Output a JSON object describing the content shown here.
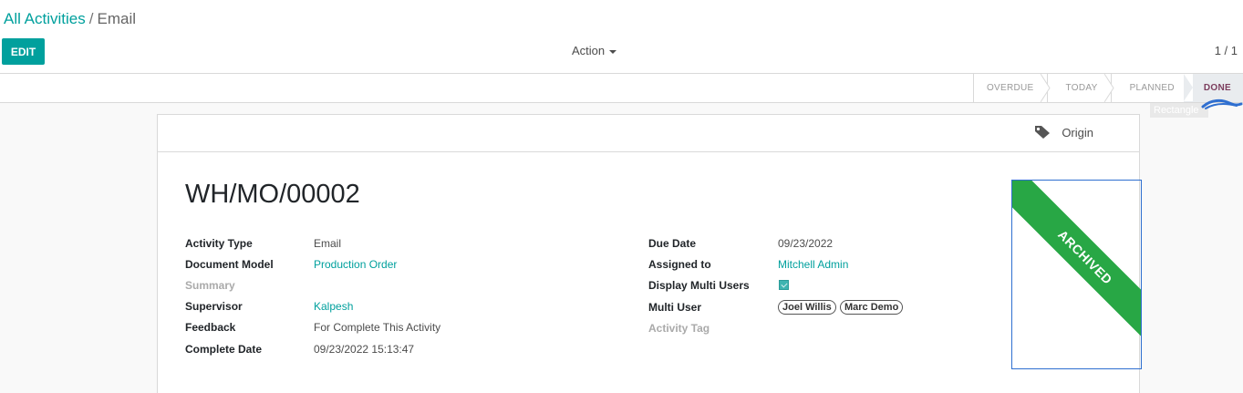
{
  "breadcrumb": {
    "parent": "All Activities",
    "separator": "/",
    "current": "Email"
  },
  "toolbar": {
    "edit_label": "EDIT",
    "action_label": "Action"
  },
  "pager": {
    "value": "1 / 1"
  },
  "statusbar": {
    "steps": [
      "OVERDUE",
      "TODAY",
      "PLANNED",
      "DONE"
    ],
    "active": "DONE"
  },
  "tooltip": {
    "label": "Rectangle"
  },
  "button_box": {
    "origin_label": "Origin"
  },
  "record": {
    "title": "WH/MO/00002",
    "ribbon": "ARCHIVED",
    "left_fields": {
      "activity_type": {
        "label": "Activity Type",
        "value": "Email"
      },
      "document_model": {
        "label": "Document Model",
        "value": "Production Order"
      },
      "summary": {
        "label": "Summary",
        "value": ""
      },
      "supervisor": {
        "label": "Supervisor",
        "value": "Kalpesh"
      },
      "feedback": {
        "label": "Feedback",
        "value": "For Complete This Activity"
      },
      "complete_date": {
        "label": "Complete Date",
        "value": "09/23/2022 15:13:47"
      }
    },
    "right_fields": {
      "due_date": {
        "label": "Due Date",
        "value": "09/23/2022"
      },
      "assigned_to": {
        "label": "Assigned to",
        "value": "Mitchell Admin"
      },
      "display_multi_users": {
        "label": "Display Multi Users",
        "checked": true
      },
      "multi_user": {
        "label": "Multi User",
        "tags": [
          "Joel Willis",
          "Marc Demo"
        ]
      },
      "activity_tag": {
        "label": "Activity Tag",
        "value": ""
      }
    }
  },
  "colors": {
    "primary": "#00a09d",
    "ribbon": "#28a745",
    "active_step": "#7c3d5d",
    "selection_outline": "#2f6fd0"
  },
  "icons": {
    "origin": "tag-icon",
    "action_caret": "caret-down-icon"
  }
}
